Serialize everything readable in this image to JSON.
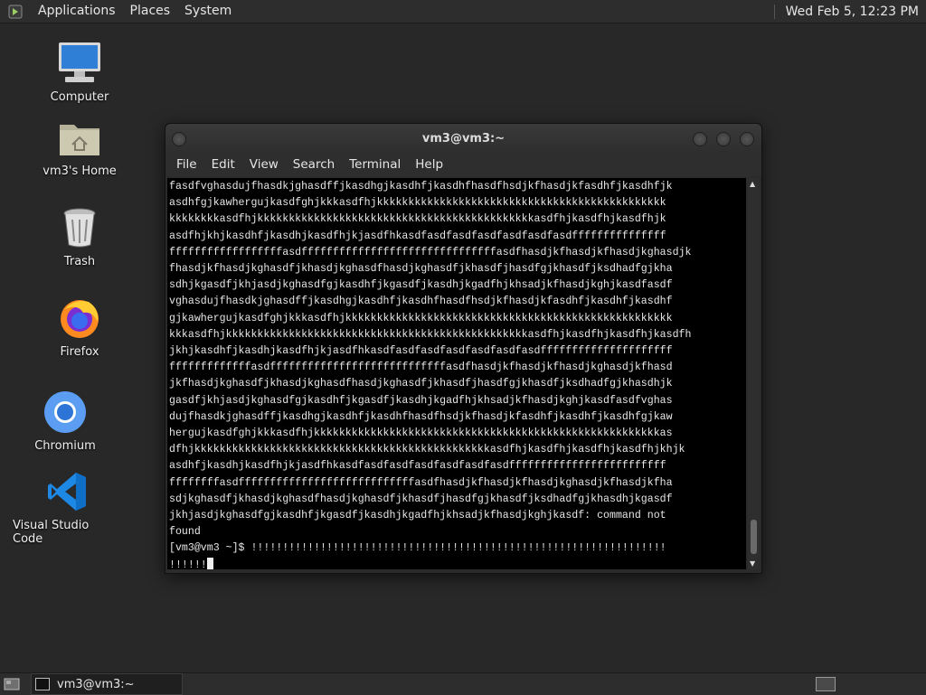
{
  "top_panel": {
    "menus": [
      "Applications",
      "Places",
      "System"
    ],
    "clock": "Wed Feb  5, 12:23 PM"
  },
  "desktop": {
    "icons": [
      {
        "label": "Computer",
        "icon": "computer-icon"
      },
      {
        "label": "vm3's Home",
        "icon": "home-folder-icon"
      },
      {
        "label": "Trash",
        "icon": "trash-icon"
      },
      {
        "label": "Firefox",
        "icon": "firefox-icon"
      },
      {
        "label": "Chromium",
        "icon": "chromium-icon"
      },
      {
        "label": "Visual Studio Code",
        "icon": "vscode-icon"
      }
    ]
  },
  "terminal": {
    "title": "vm3@vm3:~",
    "menu": [
      "File",
      "Edit",
      "View",
      "Search",
      "Terminal",
      "Help"
    ],
    "lines": [
      "fasdfvghasdujfhasdkjghasdffjkasdhgjkasdhfjkasdhfhasdfhsdjkfhasdjkfasdhfjkasdhfjk",
      "asdhfgjkawhergujkasdfghjkkkasdfhjkkkkkkkkkkkkkkkkkkkkkkkkkkkkkkkkkkkkkkkkkkkkkk",
      "kkkkkkkkasdfhjkkkkkkkkkkkkkkkkkkkkkkkkkkkkkkkkkkkkkkkkkkkkasdfhjkasdfhjkasdfhjk",
      "asdfhjkhjkasdhfjkasdhjkasdfhjkjasdfhkasdfasdfasdfasdfasdfasdfasdfffffffffffffff",
      "ffffffffffffffffffasdfffffffffffffffffffffffffffffffasdfhasdjkfhasdjkfhasdjkghasdjk",
      "fhasdjkfhasdjkghasdfjkhasdjkghasdfhasdjkghasdfjkhasdfjhasdfgjkhasdfjksdhadfgjkha",
      "sdhjkgasdfjkhjasdjkghasdfgjkasdhfjkgasdfjkasdhjkgadfhjkhsadjkfhasdjkghjkasdfasdf",
      "vghasdujfhasdkjghasdffjkasdhgjkasdhfjkasdhfhasdfhsdjkfhasdjkfasdhfjkasdhfjkasdhf",
      "gjkawhergujkasdfghjkkkasdfhjkkkkkkkkkkkkkkkkkkkkkkkkkkkkkkkkkkkkkkkkkkkkkkkkkkkk",
      "kkkasdfhjkkkkkkkkkkkkkkkkkkkkkkkkkkkkkkkkkkkkkkkkkkkkkkkkasdfhjkasdfhjkasdfhjkasdfh",
      "jkhjkasdhfjkasdhjkasdfhjkjasdfhkasdfasdfasdfasdfasdfasdfasdfffffffffffffffffffff",
      "fffffffffffffasdffffffffffffffffffffffffffffasdfhasdjkfhasdjkfhasdjkghasdjkfhasd",
      "jkfhasdjkghasdfjkhasdjkghasdfhasdjkghasdfjkhasdfjhasdfgjkhasdfjksdhadfgjkhasdhjk",
      "gasdfjkhjasdjkghasdfgjkasdhfjkgasdfjkasdhjkgadfhjkhsadjkfhasdjkghjkasdfasdfvghas",
      "dujfhasdkjghasdffjkasdhgjkasdhfjkasdhfhasdfhsdjkfhasdjkfasdhfjkasdhfjkasdhfgjkaw",
      "hergujkasdfghjkkkasdfhjkkkkkkkkkkkkkkkkkkkkkkkkkkkkkkkkkkkkkkkkkkkkkkkkkkkkkkkas",
      "dfhjkkkkkkkkkkkkkkkkkkkkkkkkkkkkkkkkkkkkkkkkkkkkkkkasdfhjkasdfhjkasdfhjkasdfhjkhjk",
      "asdhfjkasdhjkasdfhjkjasdfhkasdfasdfasdfasdfasdfasdfasdfffffffffffffffffffffffff",
      "ffffffffasdffffffffffffffffffffffffffffasdfhasdjkfhasdjkfhasdjkghasdjkfhasdjkfha",
      "sdjkghasdfjkhasdjkghasdfhasdjkghasdfjkhasdfjhasdfgjkhasdfjksdhadfgjkhasdhjkgasdf",
      "jkhjasdjkghasdfgjkasdhfjkgasdfjkasdhjkgadfhjkhsadjkfhasdjkghjkasdf: command not",
      "found",
      "[vm3@vm3 ~]$ !!!!!!!!!!!!!!!!!!!!!!!!!!!!!!!!!!!!!!!!!!!!!!!!!!!!!!!!!!!!!!!!!!",
      "!!!!!!"
    ]
  },
  "bottom_panel": {
    "task_label": "vm3@vm3:~"
  }
}
